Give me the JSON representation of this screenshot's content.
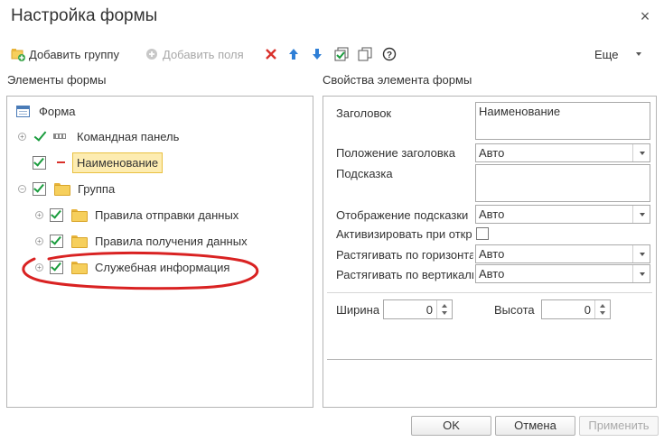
{
  "window": {
    "title": "Настройка формы"
  },
  "toolbar": {
    "add_group": "Добавить группу",
    "add_fields": "Добавить поля",
    "more": "Еще"
  },
  "left": {
    "header": "Элементы формы",
    "tree": {
      "root": "Форма",
      "command_panel": "Командная панель",
      "name_item": "Наименование",
      "group": "Группа",
      "send_rules": "Правила отправки данных",
      "receive_rules": "Правила получения данных",
      "service_info": "Служебная информация"
    }
  },
  "right": {
    "header": "Свойства элемента формы",
    "title_label": "Заголовок",
    "title_value": "Наименование",
    "title_pos_label": "Положение заголовка",
    "title_pos_value": "Авто",
    "hint_label": "Подсказка",
    "hint_value": "",
    "hint_display_label": "Отображение подсказки",
    "hint_display_value": "Авто",
    "activate_label": "Активизировать при откры",
    "stretch_h_label": "Растягивать по горизонта",
    "stretch_h_value": "Авто",
    "stretch_v_label": "Растягивать по вертикали",
    "stretch_v_value": "Авто",
    "width_label": "Ширина",
    "width_value": "0",
    "height_label": "Высота",
    "height_value": "0"
  },
  "buttons": {
    "ok": "OK",
    "cancel": "Отмена",
    "apply": "Применить"
  },
  "colors": {
    "check_green": "#1a9c3d",
    "folder_yellow": "#f6cf5c",
    "selection": "#fdecb1",
    "annotation_red": "#d92222",
    "delete_red": "#d9302a",
    "move_blue": "#2f7fd6"
  }
}
